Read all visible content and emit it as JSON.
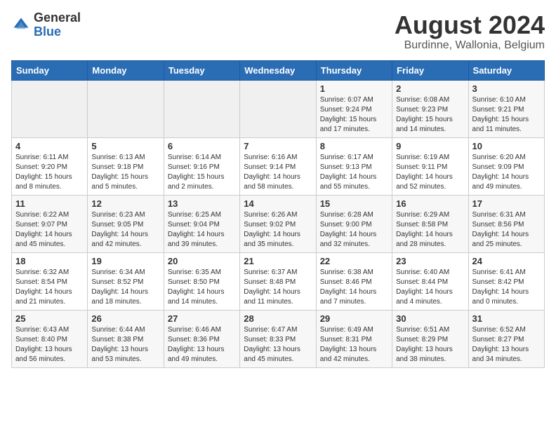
{
  "header": {
    "logo_general": "General",
    "logo_blue": "Blue",
    "month_title": "August 2024",
    "location": "Burdinne, Wallonia, Belgium"
  },
  "weekdays": [
    "Sunday",
    "Monday",
    "Tuesday",
    "Wednesday",
    "Thursday",
    "Friday",
    "Saturday"
  ],
  "weeks": [
    [
      {
        "day": "",
        "info": ""
      },
      {
        "day": "",
        "info": ""
      },
      {
        "day": "",
        "info": ""
      },
      {
        "day": "",
        "info": ""
      },
      {
        "day": "1",
        "info": "Sunrise: 6:07 AM\nSunset: 9:24 PM\nDaylight: 15 hours\nand 17 minutes."
      },
      {
        "day": "2",
        "info": "Sunrise: 6:08 AM\nSunset: 9:23 PM\nDaylight: 15 hours\nand 14 minutes."
      },
      {
        "day": "3",
        "info": "Sunrise: 6:10 AM\nSunset: 9:21 PM\nDaylight: 15 hours\nand 11 minutes."
      }
    ],
    [
      {
        "day": "4",
        "info": "Sunrise: 6:11 AM\nSunset: 9:20 PM\nDaylight: 15 hours\nand 8 minutes."
      },
      {
        "day": "5",
        "info": "Sunrise: 6:13 AM\nSunset: 9:18 PM\nDaylight: 15 hours\nand 5 minutes."
      },
      {
        "day": "6",
        "info": "Sunrise: 6:14 AM\nSunset: 9:16 PM\nDaylight: 15 hours\nand 2 minutes."
      },
      {
        "day": "7",
        "info": "Sunrise: 6:16 AM\nSunset: 9:14 PM\nDaylight: 14 hours\nand 58 minutes."
      },
      {
        "day": "8",
        "info": "Sunrise: 6:17 AM\nSunset: 9:13 PM\nDaylight: 14 hours\nand 55 minutes."
      },
      {
        "day": "9",
        "info": "Sunrise: 6:19 AM\nSunset: 9:11 PM\nDaylight: 14 hours\nand 52 minutes."
      },
      {
        "day": "10",
        "info": "Sunrise: 6:20 AM\nSunset: 9:09 PM\nDaylight: 14 hours\nand 49 minutes."
      }
    ],
    [
      {
        "day": "11",
        "info": "Sunrise: 6:22 AM\nSunset: 9:07 PM\nDaylight: 14 hours\nand 45 minutes."
      },
      {
        "day": "12",
        "info": "Sunrise: 6:23 AM\nSunset: 9:05 PM\nDaylight: 14 hours\nand 42 minutes."
      },
      {
        "day": "13",
        "info": "Sunrise: 6:25 AM\nSunset: 9:04 PM\nDaylight: 14 hours\nand 39 minutes."
      },
      {
        "day": "14",
        "info": "Sunrise: 6:26 AM\nSunset: 9:02 PM\nDaylight: 14 hours\nand 35 minutes."
      },
      {
        "day": "15",
        "info": "Sunrise: 6:28 AM\nSunset: 9:00 PM\nDaylight: 14 hours\nand 32 minutes."
      },
      {
        "day": "16",
        "info": "Sunrise: 6:29 AM\nSunset: 8:58 PM\nDaylight: 14 hours\nand 28 minutes."
      },
      {
        "day": "17",
        "info": "Sunrise: 6:31 AM\nSunset: 8:56 PM\nDaylight: 14 hours\nand 25 minutes."
      }
    ],
    [
      {
        "day": "18",
        "info": "Sunrise: 6:32 AM\nSunset: 8:54 PM\nDaylight: 14 hours\nand 21 minutes."
      },
      {
        "day": "19",
        "info": "Sunrise: 6:34 AM\nSunset: 8:52 PM\nDaylight: 14 hours\nand 18 minutes."
      },
      {
        "day": "20",
        "info": "Sunrise: 6:35 AM\nSunset: 8:50 PM\nDaylight: 14 hours\nand 14 minutes."
      },
      {
        "day": "21",
        "info": "Sunrise: 6:37 AM\nSunset: 8:48 PM\nDaylight: 14 hours\nand 11 minutes."
      },
      {
        "day": "22",
        "info": "Sunrise: 6:38 AM\nSunset: 8:46 PM\nDaylight: 14 hours\nand 7 minutes."
      },
      {
        "day": "23",
        "info": "Sunrise: 6:40 AM\nSunset: 8:44 PM\nDaylight: 14 hours\nand 4 minutes."
      },
      {
        "day": "24",
        "info": "Sunrise: 6:41 AM\nSunset: 8:42 PM\nDaylight: 14 hours\nand 0 minutes."
      }
    ],
    [
      {
        "day": "25",
        "info": "Sunrise: 6:43 AM\nSunset: 8:40 PM\nDaylight: 13 hours\nand 56 minutes."
      },
      {
        "day": "26",
        "info": "Sunrise: 6:44 AM\nSunset: 8:38 PM\nDaylight: 13 hours\nand 53 minutes."
      },
      {
        "day": "27",
        "info": "Sunrise: 6:46 AM\nSunset: 8:36 PM\nDaylight: 13 hours\nand 49 minutes."
      },
      {
        "day": "28",
        "info": "Sunrise: 6:47 AM\nSunset: 8:33 PM\nDaylight: 13 hours\nand 45 minutes."
      },
      {
        "day": "29",
        "info": "Sunrise: 6:49 AM\nSunset: 8:31 PM\nDaylight: 13 hours\nand 42 minutes."
      },
      {
        "day": "30",
        "info": "Sunrise: 6:51 AM\nSunset: 8:29 PM\nDaylight: 13 hours\nand 38 minutes."
      },
      {
        "day": "31",
        "info": "Sunrise: 6:52 AM\nSunset: 8:27 PM\nDaylight: 13 hours\nand 34 minutes."
      }
    ]
  ]
}
